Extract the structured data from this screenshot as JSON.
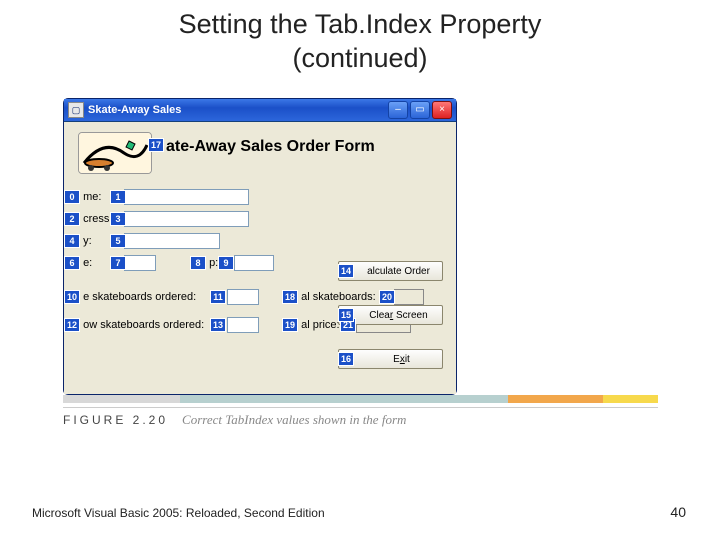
{
  "slide": {
    "title_line1": "Setting the Tab.Index Property",
    "title_line2": "(continued)"
  },
  "window": {
    "title": "Skate-Away Sales",
    "icon_char": "▢",
    "min_char": "–",
    "max_char": "▭",
    "close_char": "×"
  },
  "form": {
    "heading": "ate-Away Sales Order Form",
    "heading_tab": "17",
    "fields": {
      "name_full": "Name:",
      "name_vis": "me:",
      "addr_full": "Address:",
      "addr_vis": "cress:",
      "city_full": "City:",
      "city_vis": "y:",
      "state_full": "State:",
      "state_vis": "e:",
      "zip_full": "ZIP:",
      "zip_vis": "p:",
      "blue_full": "Blue skateboards ordered:",
      "blue_vis": "e skateboards ordered:",
      "yellow_full": "Yellow skateboards ordered:",
      "yellow_vis": "ow skateboards ordered:",
      "total_full": "Total skateboards:",
      "total_vis": "al skateboards:",
      "price_full": "Total price:",
      "price_vis": "al price:"
    },
    "tabs": {
      "name_lbl": "0",
      "name_box": "1",
      "addr_lbl": "2",
      "addr_box": "3",
      "city_lbl": "4",
      "city_box": "5",
      "state_lbl": "6",
      "state_box": "7",
      "zip_lbl": "8",
      "zip_box": "9",
      "blue_lbl": "10",
      "blue_box": "11",
      "yellow_lbl": "12",
      "yellow_box": "13",
      "calc_btn": "14",
      "clear_btn": "15",
      "exit_btn": "16",
      "total_lbl": "18",
      "price_lbl": "19",
      "total_box": "20",
      "price_box": "21"
    },
    "buttons": {
      "calc_full": "Calculate Order",
      "calc_vis": "alculate Order",
      "clear_full": "Clear Screen",
      "clear_vis_pre": "Clea",
      "clear_u": "r",
      "clear_vis_post": " Screen",
      "exit_full": "Exit",
      "exit_u": "x",
      "exit_pre": "E",
      "exit_post": "it"
    }
  },
  "figure": {
    "label": "FIGURE 2.20",
    "caption": "Correct TabIndex values shown in the form"
  },
  "footer": {
    "text": "Microsoft Visual Basic 2005: Reloaded, Second Edition",
    "page": "40"
  }
}
